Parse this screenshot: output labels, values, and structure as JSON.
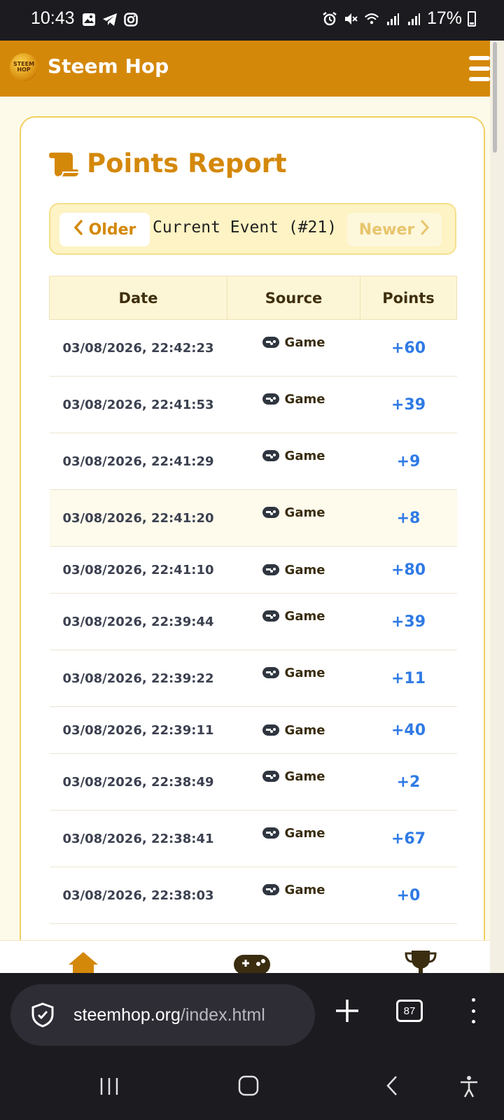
{
  "status_bar": {
    "time": "10:43",
    "battery": "17%",
    "left_icons": [
      "gallery-icon",
      "telegram-icon",
      "instagram-icon"
    ],
    "right_icons": [
      "alarm-icon",
      "mute-icon",
      "wifi-icon",
      "signal-icon",
      "signal-icon"
    ]
  },
  "app": {
    "title": "Steem Hop",
    "logo_text": "STEEM HOP",
    "accent_color": "#d4880a"
  },
  "report": {
    "heading": "Points Report",
    "older_label": "Older",
    "newer_label": "Newer",
    "event_label": "Current Event (#21)"
  },
  "table": {
    "columns": [
      "Date",
      "Source",
      "Points"
    ],
    "rows": [
      {
        "date": "03/08/2026, 22:42:23",
        "source": "Game",
        "points": "+60"
      },
      {
        "date": "03/08/2026, 22:41:53",
        "source": "Game",
        "points": "+39"
      },
      {
        "date": "03/08/2026, 22:41:29",
        "source": "Game",
        "points": "+9"
      },
      {
        "date": "03/08/2026, 22:41:20",
        "source": "Game",
        "points": "+8"
      },
      {
        "date": "03/08/2026, 22:41:10",
        "source": "Game",
        "points": "+80"
      },
      {
        "date": "03/08/2026, 22:39:44",
        "source": "Game",
        "points": "+39"
      },
      {
        "date": "03/08/2026, 22:39:22",
        "source": "Game",
        "points": "+11"
      },
      {
        "date": "03/08/2026, 22:39:11",
        "source": "Game",
        "points": "+40"
      },
      {
        "date": "03/08/2026, 22:38:49",
        "source": "Game",
        "points": "+2"
      },
      {
        "date": "03/08/2026, 22:38:41",
        "source": "Game",
        "points": "+67"
      },
      {
        "date": "03/08/2026, 22:38:03",
        "source": "Game",
        "points": "+0"
      }
    ]
  },
  "bottom_nav": [
    "home-icon",
    "gamepad-icon",
    "trophy-icon"
  ],
  "browser": {
    "url_domain": "steemhop.org",
    "url_path": "/index.html",
    "tab_count": "87"
  }
}
